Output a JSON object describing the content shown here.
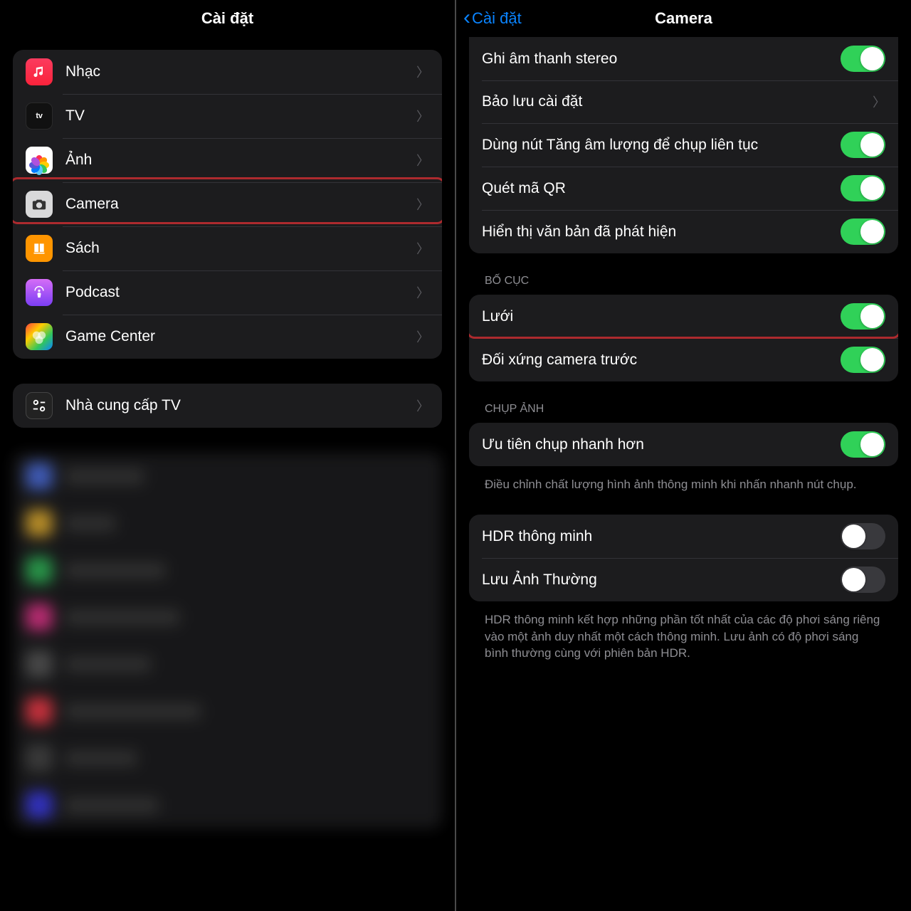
{
  "left": {
    "title": "Cài đặt",
    "items": [
      {
        "label": "Nhạc"
      },
      {
        "label": "TV"
      },
      {
        "label": "Ảnh"
      },
      {
        "label": "Camera"
      },
      {
        "label": "Sách"
      },
      {
        "label": "Podcast"
      },
      {
        "label": "Game Center"
      }
    ],
    "provider_label": "Nhà cung cấp TV"
  },
  "right": {
    "back_label": "Cài đặt",
    "title": "Camera",
    "group1": [
      {
        "label": "Ghi âm thanh stereo",
        "type": "toggle",
        "on": true
      },
      {
        "label": "Bảo lưu cài đặt",
        "type": "nav"
      },
      {
        "label": "Dùng nút Tăng âm lượng để chụp liên tục",
        "type": "toggle",
        "on": true
      },
      {
        "label": "Quét mã QR",
        "type": "toggle",
        "on": true
      },
      {
        "label": "Hiển thị văn bản đã phát hiện",
        "type": "toggle",
        "on": true
      }
    ],
    "section_layout": "BỐ CỤC",
    "group_layout": [
      {
        "label": "Lưới",
        "on": true
      },
      {
        "label": "Đối xứng camera trước",
        "on": true
      }
    ],
    "section_capture": "CHỤP ẢNH",
    "group_capture": [
      {
        "label": "Ưu tiên chụp nhanh hơn",
        "on": true
      }
    ],
    "footer_capture": "Điều chỉnh chất lượng hình ảnh thông minh khi nhấn nhanh nút chụp.",
    "group_hdr": [
      {
        "label": "HDR thông minh",
        "on": false
      },
      {
        "label": "Lưu Ảnh Thường",
        "on": false
      }
    ],
    "footer_hdr": "HDR thông minh kết hợp những phần tốt nhất của các độ phơi sáng riêng vào một ảnh duy nhất một cách thông minh. Lưu ảnh có độ phơi sáng bình thường cùng với phiên bản HDR."
  }
}
